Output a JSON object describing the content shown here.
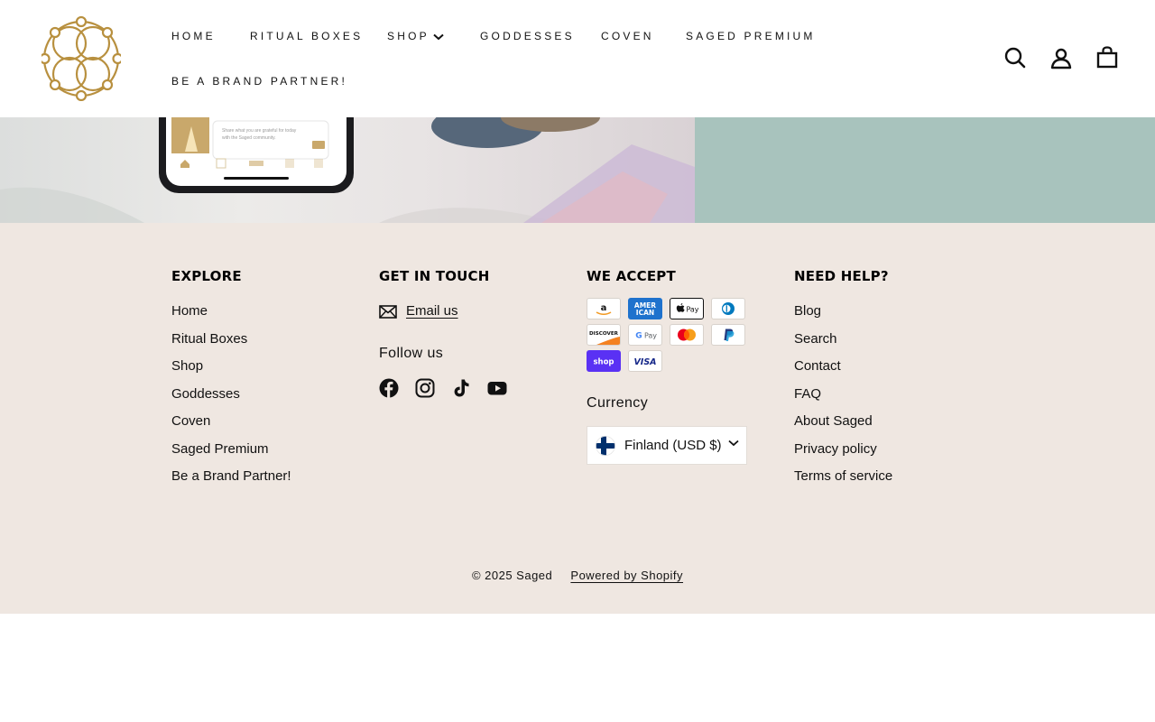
{
  "brand": {
    "name": "Saged",
    "logo_color": "#b8903f"
  },
  "nav": {
    "items": [
      {
        "label": "Home"
      },
      {
        "label": "Ritual Boxes"
      },
      {
        "label": "Shop"
      },
      {
        "label": "Goddesses"
      },
      {
        "label": "Coven"
      },
      {
        "label": "Saged Premium"
      },
      {
        "label": "Be a Brand Partner!"
      }
    ]
  },
  "header_icons": [
    "search-icon",
    "account-icon",
    "cart-icon"
  ],
  "hero": {
    "phone_text": "Share what you are grateful for today with the Saged community."
  },
  "footer": {
    "background": "#efe7e1",
    "explore": {
      "title": "EXPLORE",
      "links": [
        "Home",
        "Ritual Boxes",
        "Shop",
        "Goddesses",
        "Coven",
        "Saged Premium",
        "Be a Brand Partner!"
      ]
    },
    "contact": {
      "title": "GET IN TOUCH",
      "email_label": "Email us",
      "follow_label": "Follow us",
      "social": [
        "facebook-icon",
        "instagram-icon",
        "tiktok-icon",
        "youtube-icon"
      ]
    },
    "accept": {
      "title": "WE ACCEPT",
      "methods": [
        "Amazon",
        "American Express",
        "Apple Pay",
        "Diners Club",
        "Discover",
        "Google Pay",
        "Mastercard",
        "PayPal",
        "Shop Pay",
        "Visa"
      ],
      "currency_label": "Currency",
      "currency_value": "Finland (USD $)"
    },
    "help": {
      "title": "NEED HELP?",
      "links": [
        "Blog",
        "Search",
        "Contact",
        "FAQ",
        "About Saged",
        "Privacy policy",
        "Terms of service"
      ]
    },
    "copyright": "© 2025 Saged",
    "powered": "Powered by Shopify"
  }
}
